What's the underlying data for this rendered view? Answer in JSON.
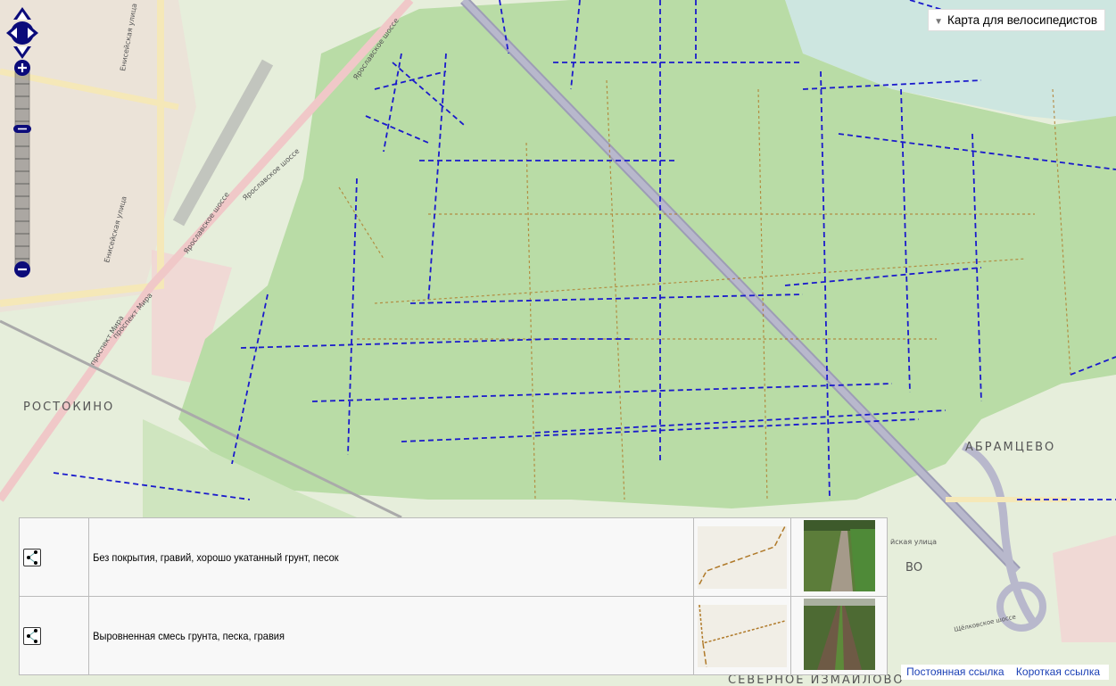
{
  "map": {
    "labels": {
      "rostokino": "РОСТОКИНО",
      "abramtsevo": "АБРАМЦЕВО",
      "yaroslavskoe1": "Ярославское шоссе",
      "yaroslavskoe2": "Ярославское шоссе",
      "yaroslavskoe3": "Ярославское шоссе",
      "prospekt_mira1": "проспект Мира",
      "prospekt_mira2": "проспект Мира",
      "eniseyskaya1": "Енисейская улица",
      "eniseyskaya2": "Енисейская улица",
      "shchelkovskoe": "Щёлковское шоссе",
      "severnoe_izmaylovo": "СЕВЕРНОЕ ИЗМАЙЛОВО",
      "street_partial": "йская улица",
      "vo_partial": "ВО"
    },
    "colors": {
      "forest": "#b9dca6",
      "base": "#e6eedb",
      "trail": "#1a1acc",
      "highway": "#b0b0c4",
      "track": "#b07a2a"
    }
  },
  "controls": {
    "pan_icon": "pan-arrows-icon",
    "zoom_in": "+",
    "zoom_out": "−",
    "zoom_level_fraction": 0.3
  },
  "layer_switcher": {
    "label": "Карта для велосипедистов"
  },
  "legend": {
    "rows": [
      {
        "icon": "share-nodes-icon",
        "text": "Без покрытия, гравий, хорошо укатанный грунт, песок",
        "swatch_style": "dashed"
      },
      {
        "icon": "share-nodes-icon",
        "text": "Выровненная смесь грунта, песка, гравия",
        "swatch_style": "dotted"
      }
    ]
  },
  "footer": {
    "permalink": "Постоянная ссылка",
    "shortlink": "Короткая ссылка"
  }
}
